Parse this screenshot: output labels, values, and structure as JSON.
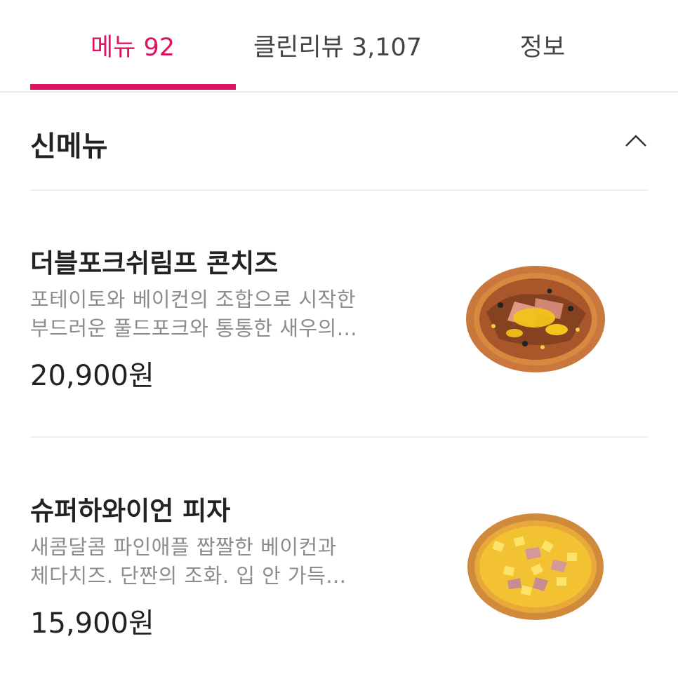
{
  "tabs": [
    {
      "label": "메뉴 92",
      "active": true
    },
    {
      "label": "클린리뷰 3,107",
      "active": false
    },
    {
      "label": "정보",
      "active": false
    }
  ],
  "section": {
    "title": "신메뉴",
    "collapse_icon": "chevron-up-icon"
  },
  "menu_items": [
    {
      "name": "더블포크쉬림프 콘치즈",
      "description_line1": "포테이토와 베이컨의 조합으로 시작한",
      "description_line2": "부드러운 풀드포크와 통통한 새우의...",
      "price": "20,900원",
      "image_icon": "pizza-image"
    },
    {
      "name": "슈퍼하와이언 피자",
      "description_line1": "새콤달콤 파인애플 짭짤한 베이컨과",
      "description_line2": "체다치즈. 단짠의 조화. 입 안 가득...",
      "price": "15,900원",
      "image_icon": "pizza-image"
    }
  ],
  "colors": {
    "accent": "#e0115f",
    "text": "#222222",
    "muted": "#8c8c8c",
    "divider": "#efefef"
  }
}
